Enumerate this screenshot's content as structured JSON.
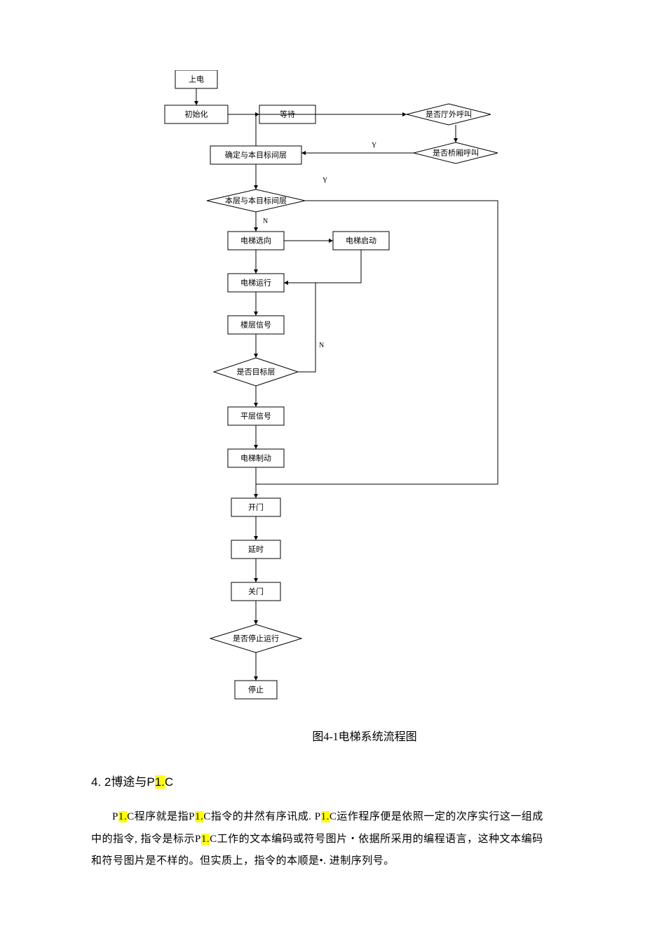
{
  "flow": {
    "n1": "上电",
    "n2": "初始化",
    "n3": "等待",
    "n4": "是否厅外呼叫",
    "n5": "是否桥厢呼叫",
    "n6": "确定与本目标间层",
    "n7": "本层与本目标间层",
    "n8": "电梯选向",
    "n9": "电梯启动",
    "n10": "电梯运行",
    "n11": "楼层信号",
    "n12": "是否目标层",
    "n13": "平层信号",
    "n14": "电梯制动",
    "n15": "开门",
    "n16": "延时",
    "n17": "关门",
    "n18": "是否停止运行",
    "n19": "停止",
    "ly": "Y",
    "ln": "N"
  },
  "caption": "图4-1电梯系统流程图",
  "heading_prefix": "4.   2博途与P",
  "heading_hl": "1.",
  "heading_suffix": "C",
  "para_parts": {
    "p1": "P",
    "h1": "1.",
    "p2": "C程序就是指P",
    "h2": "1.",
    "p3": "C指令的井然有序讯成. P",
    "h3": "1.",
    "p4": "C运作程序便是依照一定的次序实行这一组成中的指令, 指令是标示P",
    "h4": "1.",
    "p5": "C工作的文本编码或符号图片・依据所采用的编程语言，这种文本编码和符号图片是不样的。但实质上，指令的本顺是•. 进制序列号。"
  }
}
